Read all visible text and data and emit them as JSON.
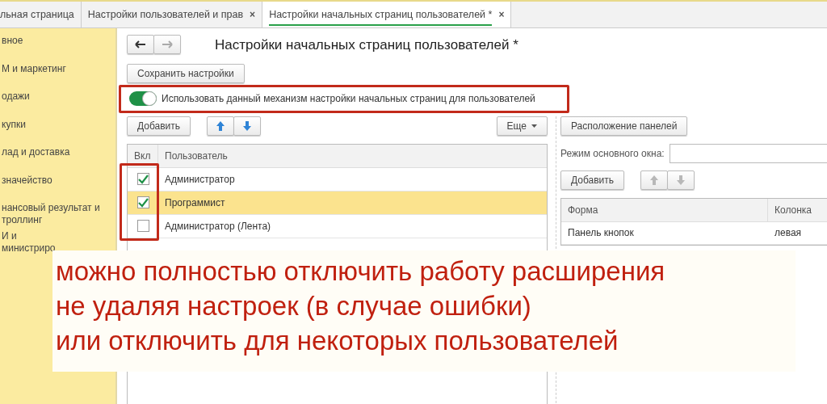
{
  "tabs": [
    {
      "label": "льная страница",
      "selected": false
    },
    {
      "label": "Настройки пользователей и прав",
      "selected": false,
      "close": "×"
    },
    {
      "label": "Настройки начальных страниц пользователей *",
      "selected": true,
      "close": "×"
    }
  ],
  "sidebar": {
    "items": [
      "вное",
      "М и маркетинг",
      "одажи",
      "купки",
      "лад и доставка",
      "значейство",
      "нансовый результат и\nтроллинг",
      "И и\nминистриро"
    ]
  },
  "form": {
    "title": "Настройки начальных страниц пользователей *",
    "save_button": "Сохранить настройки",
    "toggle": {
      "label": "Использовать данный механизм настройки начальных страниц для пользователей",
      "on": true
    },
    "left_pane": {
      "add_button": "Добавить",
      "arrows_enabled": true,
      "more_button": "Еще",
      "table": {
        "columns": [
          "Вкл",
          "Пользователь"
        ],
        "rows": [
          {
            "checked": true,
            "user": "Администратор",
            "selected": false
          },
          {
            "checked": true,
            "user": "Программист",
            "selected": true
          },
          {
            "checked": false,
            "user": "Администратор (Лента)",
            "selected": false
          }
        ]
      }
    },
    "right_pane": {
      "layout_button": "Расположение панелей",
      "mode_label": "Режим основного окна:",
      "add_button": "Добавить",
      "arrows_enabled": false,
      "table": {
        "columns": [
          "Форма",
          "Колонка"
        ],
        "rows": [
          {
            "form": "Панель кнопок",
            "column": "левая",
            "selected": false
          }
        ]
      }
    }
  },
  "annotation": {
    "lines": [
      "можно полностью отключить работу расширения",
      "не удаляя настроек (в случае ошибки)",
      "или отключить для некоторых пользователей"
    ]
  }
}
